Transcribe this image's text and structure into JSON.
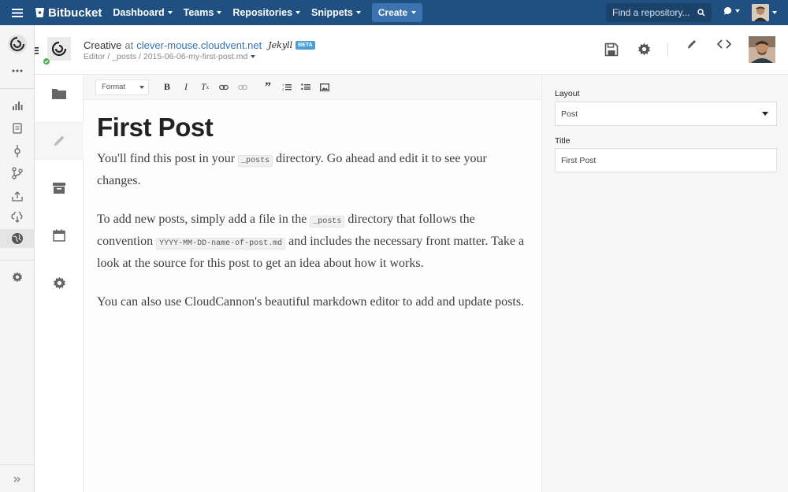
{
  "topbar": {
    "brand": "Bitbucket",
    "nav": [
      {
        "label": "Dashboard"
      },
      {
        "label": "Teams"
      },
      {
        "label": "Repositories"
      },
      {
        "label": "Snippets"
      }
    ],
    "create_label": "Create",
    "search_placeholder": "Find a repository..."
  },
  "site": {
    "name": "Creative",
    "at": "at",
    "domain": "clever-mouse.cloudvent.net",
    "jekyll": "Jekyll",
    "beta": "BETA",
    "breadcrumb": "Editor / _posts / 2015-06-06-my-first-post.md"
  },
  "editor": {
    "format_label": "Format",
    "heading": "First Post",
    "p1_a": "You'll find this post in your ",
    "p1_code": "_posts",
    "p1_b": " directory. Go ahead and edit it to see your changes.",
    "p2_a": "To add new posts, simply add a file in the ",
    "p2_code1": "_posts",
    "p2_b": " directory that follows the convention ",
    "p2_code2": "YYYY-MM-DD-name-of-post.md",
    "p2_c": " and includes the necessary front matter. Take a look at the source for this post to get an idea about how it works.",
    "p3": "You can also use CloudCannon's beautiful markdown editor to add and update posts."
  },
  "panel": {
    "layout_label": "Layout",
    "layout_value": "Post",
    "title_label": "Title",
    "title_value": "First Post"
  },
  "colors": {
    "topbar": "#205081",
    "create": "#3b73af",
    "link": "#3572b0",
    "status_ok": "#4caf50"
  }
}
